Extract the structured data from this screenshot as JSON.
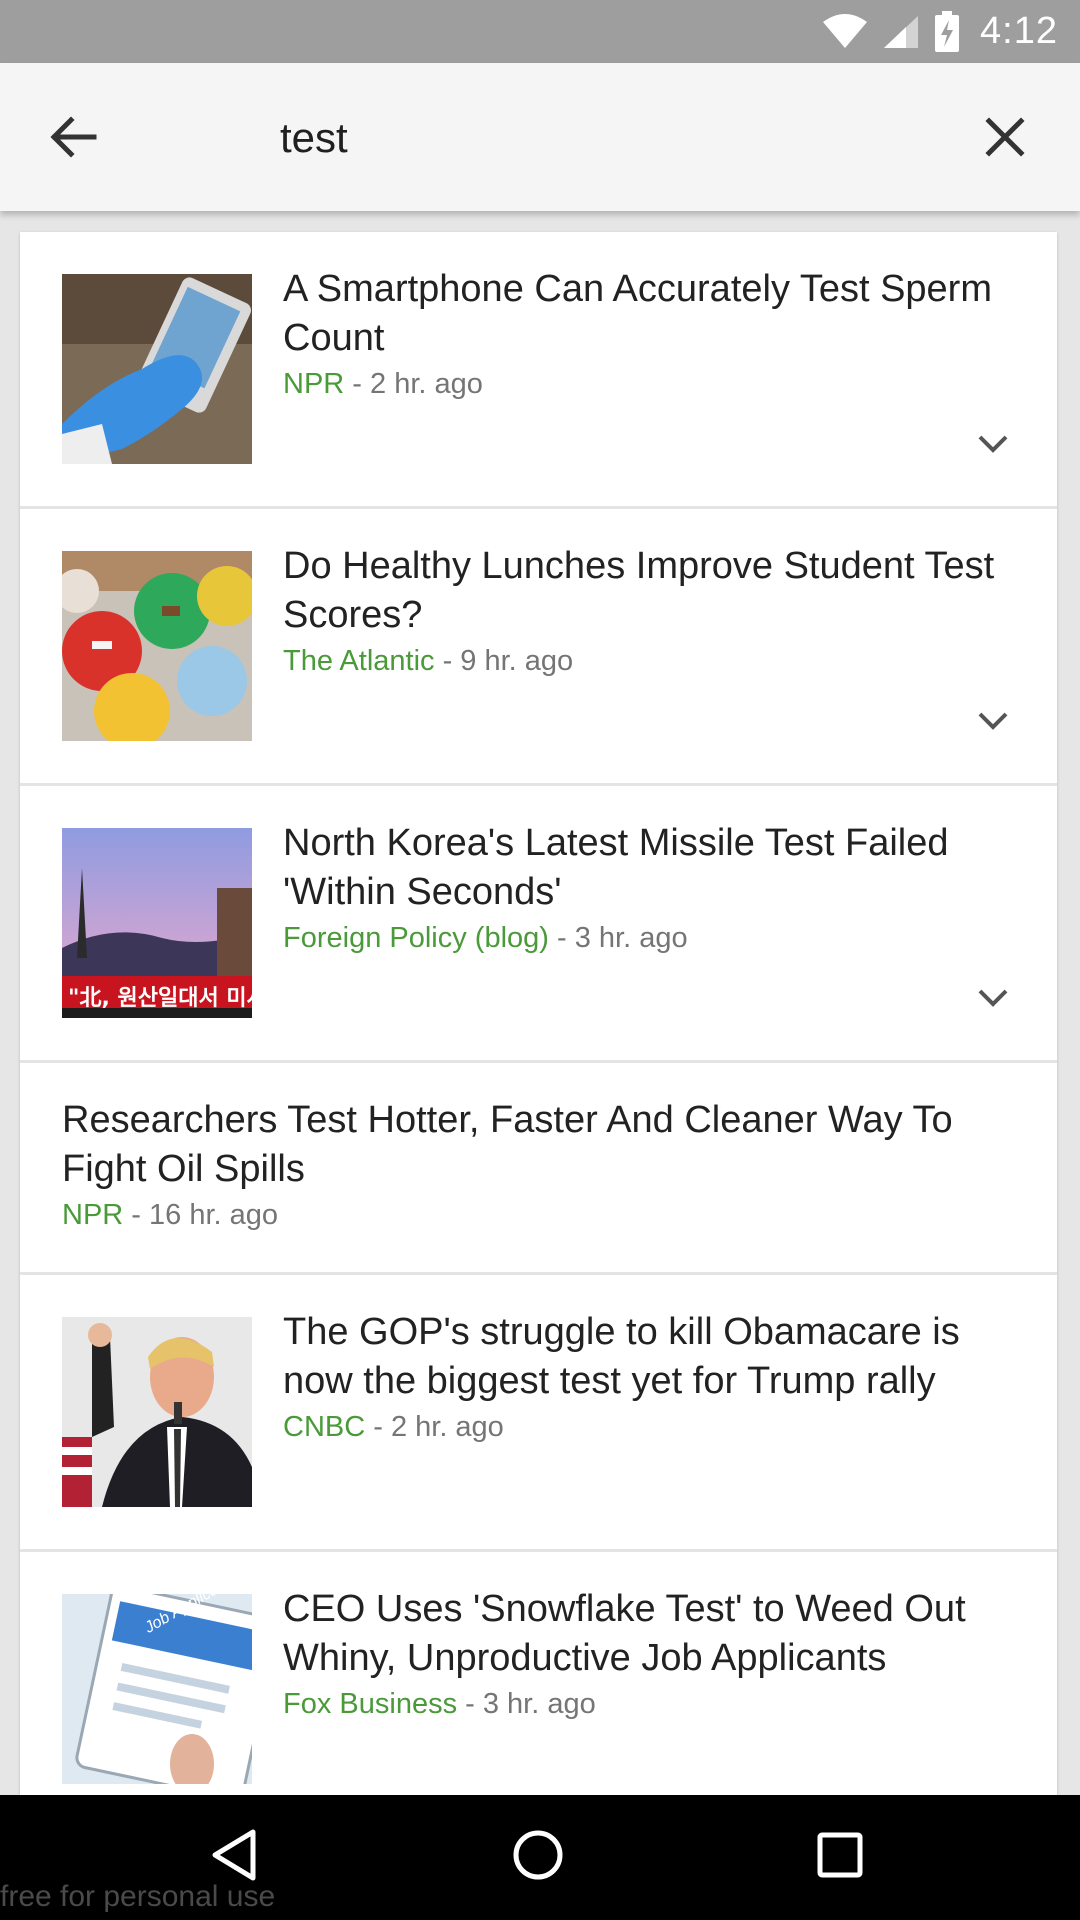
{
  "status_bar": {
    "time": "4:12",
    "icons": [
      "wifi-icon",
      "cell-signal-icon",
      "battery-charging-icon"
    ]
  },
  "search": {
    "query": "test",
    "back_icon": "arrow-left-icon",
    "clear_icon": "close-icon"
  },
  "results": [
    {
      "headline": "A Smartphone Can Accurately Test Sperm Count",
      "source": "NPR",
      "time": " - 2 hr. ago",
      "thumbnail": "gloved-hand-phone-image",
      "expandable": true
    },
    {
      "headline": "Do Healthy Lunches Improve Student Test Scores?",
      "source": "The Atlantic",
      "time": " - 9 hr. ago",
      "thumbnail": "lunch-trays-image",
      "expandable": true
    },
    {
      "headline": "North Korea's Latest Missile Test Failed 'Within Seconds'",
      "source": "Foreign Policy (blog)",
      "time": " - 3 hr. ago",
      "thumbnail": "missile-launch-news-image",
      "thumbnail_caption": "\"北, 원산일대서 미사",
      "expandable": true
    },
    {
      "headline": "Researchers Test Hotter, Faster And Cleaner Way To Fight Oil Spills",
      "source": "NPR",
      "time": " - 16 hr. ago",
      "thumbnail": null,
      "expandable": false
    },
    {
      "headline": "The GOP's struggle to kill Obamacare is now the biggest test yet for Trump rally",
      "source": "CNBC",
      "time": " - 2 hr. ago",
      "thumbnail": "speaker-raised-fist-image",
      "expandable": false
    },
    {
      "headline": "CEO Uses 'Snowflake Test' to Weed Out Whiny, Unproductive Job Applicants",
      "source": "Fox Business",
      "time": " - 3 hr. ago",
      "thumbnail": "job-application-tablet-image",
      "thumbnail_caption": "Job Application",
      "expandable": false
    }
  ],
  "nav_bar": {
    "icons": [
      "back-triangle-icon",
      "home-circle-icon",
      "recents-square-icon"
    ]
  },
  "watermark": "free for personal use",
  "colors": {
    "status_bar": "#9e9e9e",
    "search_bar": "#f5f5f5",
    "source_green": "#4a9a3a",
    "meta_gray": "#757575",
    "nav_bar": "#000000"
  }
}
